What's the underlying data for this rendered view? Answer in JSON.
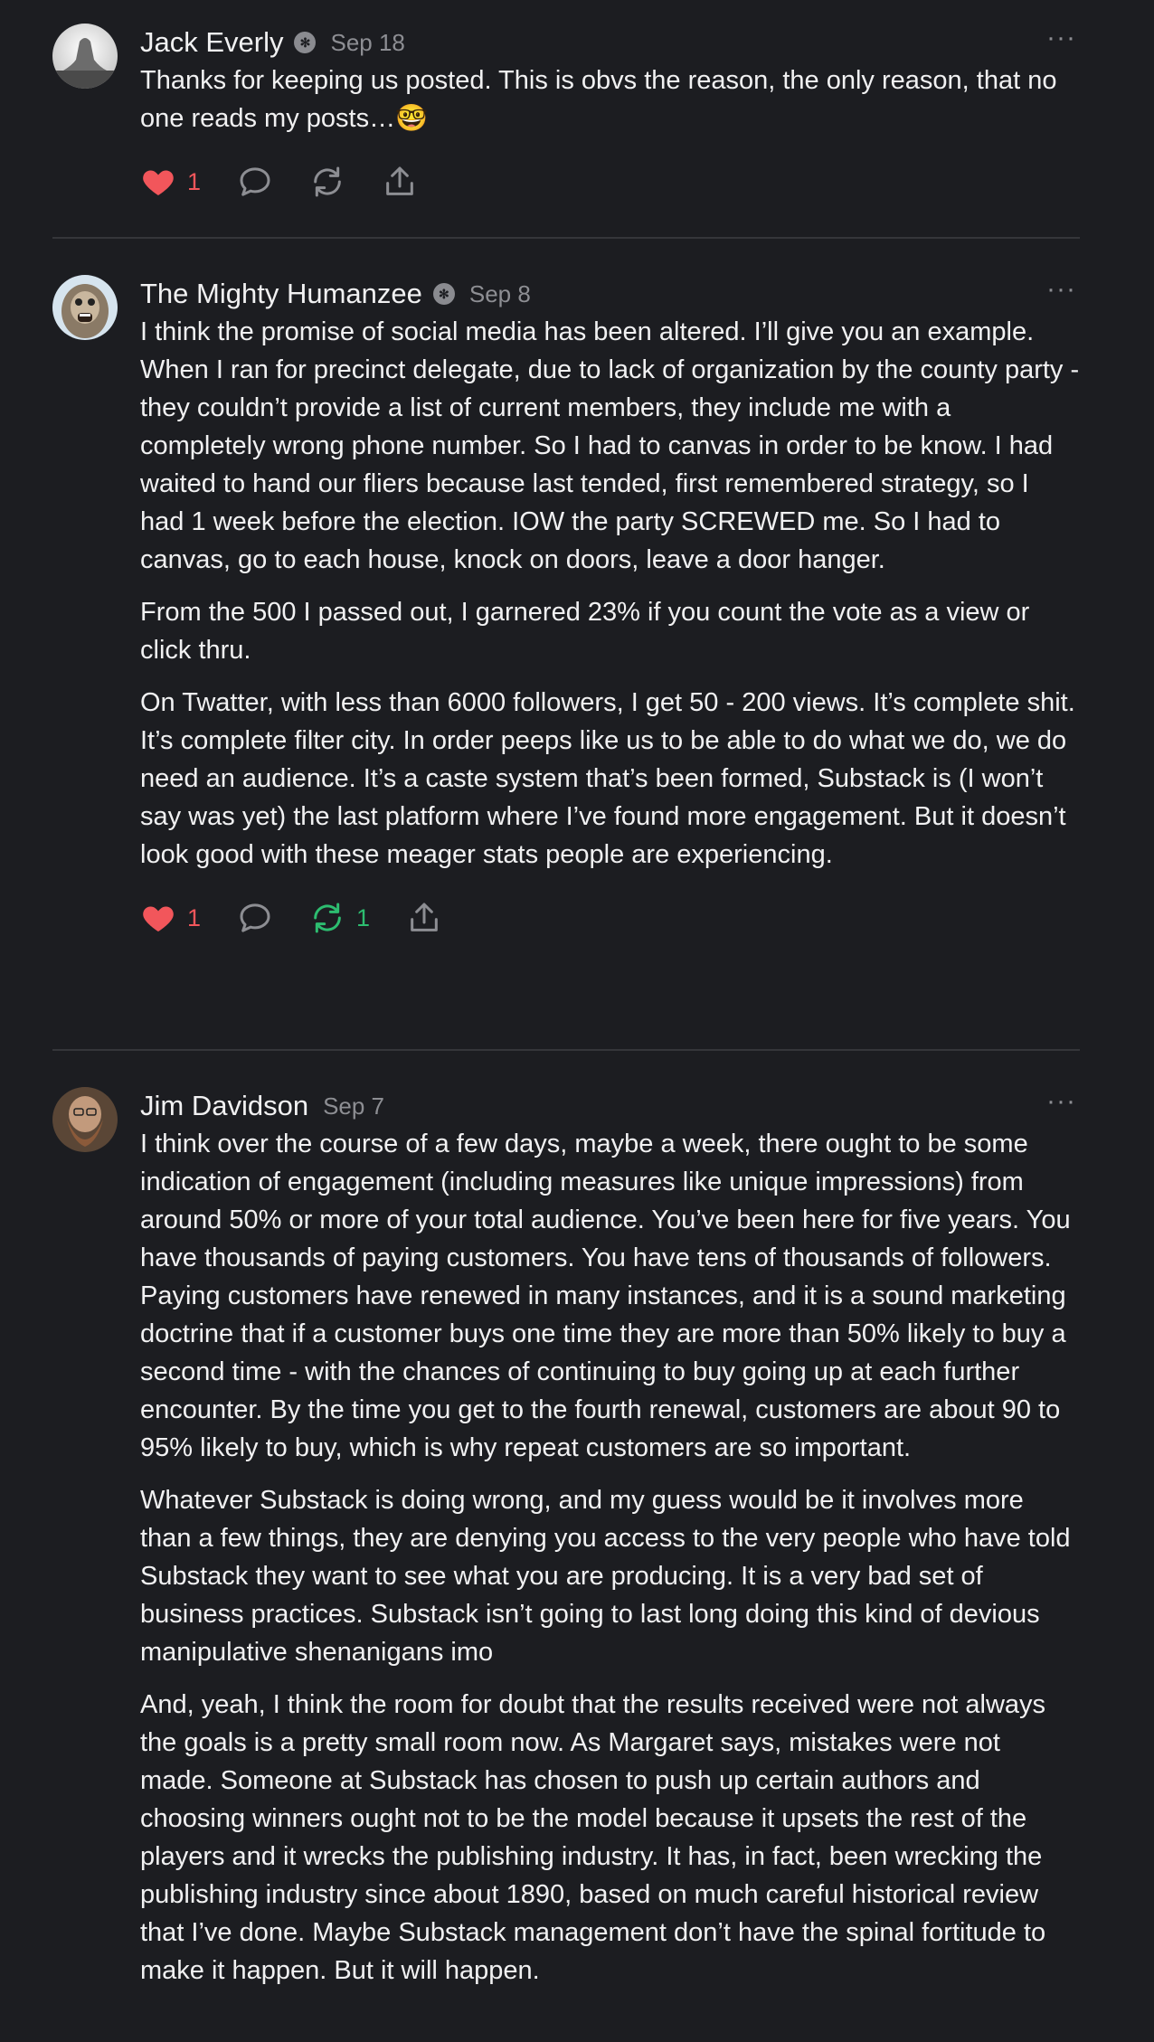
{
  "comments": [
    {
      "author": "Jack Everly",
      "date": "Sep 18",
      "paragraphs": [
        "Thanks for keeping us posted. This is obvs the reason, the only reason, that no one reads my posts…🤓"
      ],
      "likes": "1",
      "restacks": ""
    },
    {
      "author": "The Mighty Humanzee",
      "date": "Sep 8",
      "paragraphs": [
        "I think the promise of social media has been altered. I’ll give you an example. When I ran for precinct delegate, due to lack of organization by the county party - they couldn’t provide a list of current members, they include me with a completely wrong phone number. So I had to canvas in order to be know. I had waited to hand our fliers because last tended, first remembered strategy, so I had 1 week before the election. IOW the party SCREWED me. So I had to canvas, go to each house, knock on doors, leave a door hanger.",
        "From the 500 I passed out, I garnered 23% if you count the vote as a view or click thru.",
        "On Twatter, with less than 6000 followers, I get 50 - 200 views. It’s complete shit. It’s complete filter city. In order peeps like us to be able to do what we do, we do need an audience. It’s a caste system that’s been formed, Substack is (I won’t say was yet) the last platform where I’ve found more engagement. But it doesn’t look good with these meager stats people are experiencing."
      ],
      "likes": "1",
      "restacks": "1"
    },
    {
      "author": "Jim Davidson",
      "date": "Sep 7",
      "paragraphs": [
        "I think over the course of a few days, maybe a week, there ought to be some indication of engagement (including measures like unique impressions) from around 50% or more of your total audience. You’ve been here for five years. You have thousands of paying customers. You have tens of thousands of followers. Paying customers have renewed in many instances, and it is a sound marketing doctrine that if a customer buys one time they are more than 50% likely to buy a second time - with the chances of continuing to buy going up at each further encounter. By the time you get to the fourth renewal, customers are about 90 to 95% likely to buy, which is why repeat customers are so important.",
        "Whatever Substack is doing wrong, and my guess would be it involves more than a few things, they are denying you access to the very people who have told Substack they want to see what you are producing. It is a very bad set of business practices. Substack isn’t going to last long doing this kind of devious manipulative shenanigans imo",
        "And, yeah, I think the room for doubt that the results received were not always the goals is a pretty small room now. As Margaret says, mistakes were not made. Someone at Substack has chosen to push up certain authors and choosing winners ought not to be the model because it upsets the rest of the players and it wrecks the publishing industry. It has, in fact, been wrecking the publishing industry since about 1890, based on much careful historical review that I’ve done. Maybe Substack management don’t have the spinal fortitude to make it happen. But it will happen."
      ]
    }
  ],
  "icons": {
    "more": "more-options-icon",
    "like": "heart-icon",
    "reply": "comment-bubble-icon",
    "restack": "restack-icon",
    "share": "share-icon",
    "badge": "verified-badge-icon"
  },
  "colors": {
    "background": "#1c1d21",
    "like_active": "#f2565b",
    "restack_active": "#2dbd70",
    "muted": "#8d8e93"
  },
  "more_glyph": "···",
  "badge_glyph": "✻"
}
